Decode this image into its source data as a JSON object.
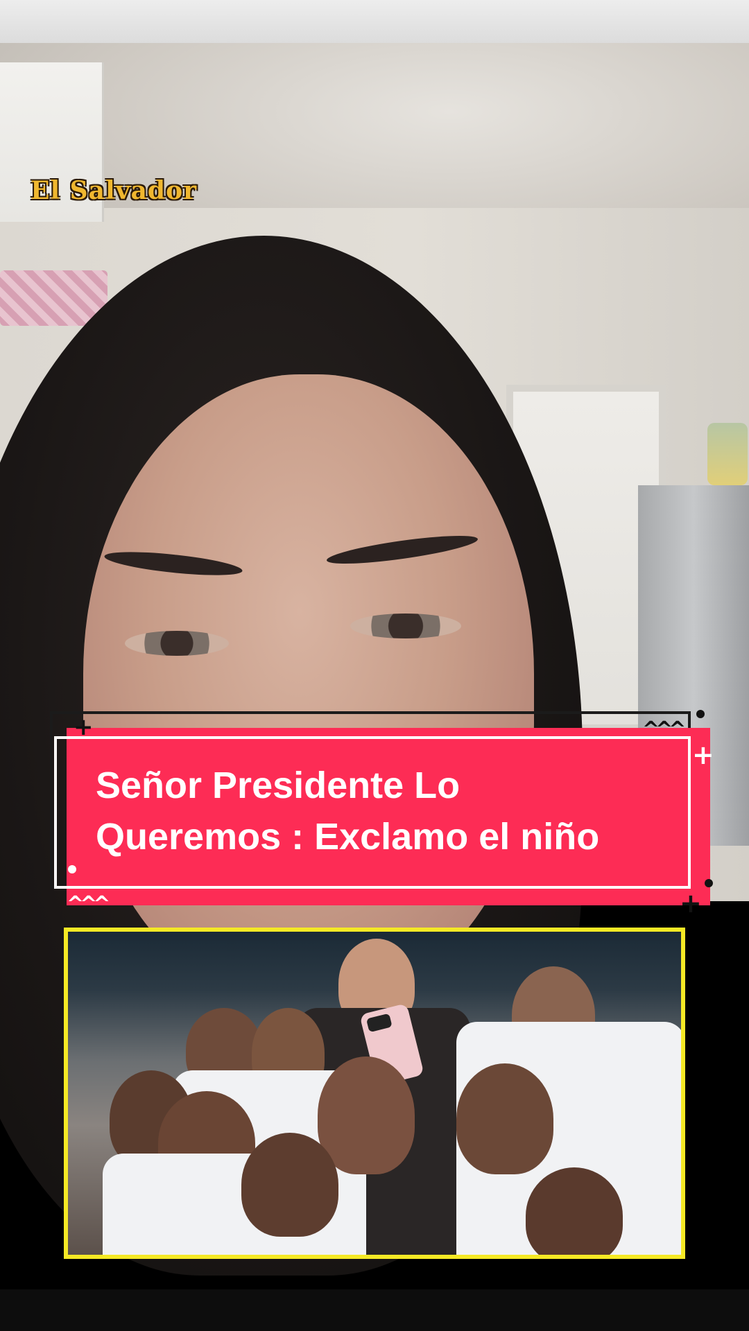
{
  "overlay": {
    "watermark": "El Salvador",
    "caption_line1": "Señor Presidente Lo",
    "caption_line2": "Queremos : Exclamo el niño"
  },
  "colors": {
    "banner": "#fd2c55",
    "watermark": "#f0b72f",
    "embed_border": "#f5e925"
  }
}
